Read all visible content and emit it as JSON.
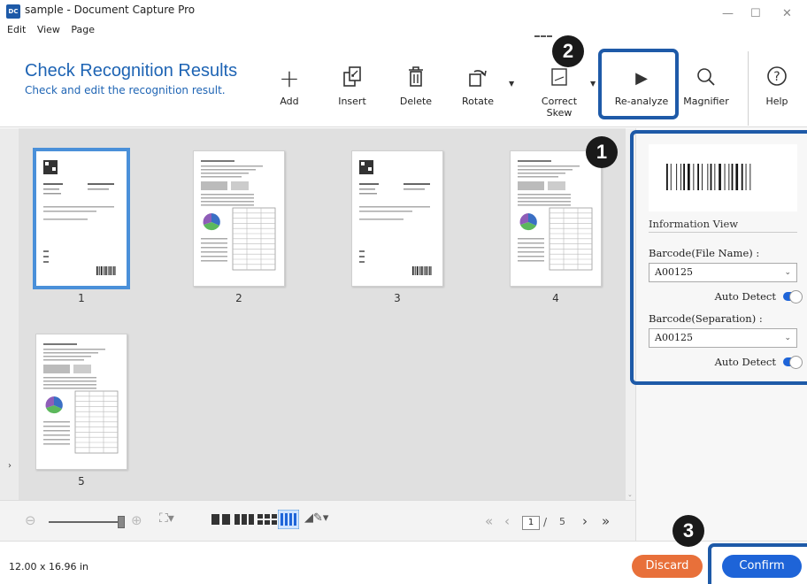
{
  "window": {
    "title": "sample - Document Capture Pro",
    "icon_text": "DC",
    "menu": [
      "Edit",
      "View",
      "Page"
    ],
    "controls": {
      "minimize": "—",
      "maximize": "☐",
      "close": "✕"
    }
  },
  "header": {
    "title": "Check Recognition Results",
    "subtitle": "Check and edit the recognition result."
  },
  "toolbar": {
    "add": "Add",
    "insert": "Insert",
    "delete": "Delete",
    "rotate": "Rotate",
    "correct_skew_1": "Correct",
    "correct_skew_2": "Skew",
    "reanalyze": "Re-analyze",
    "magnifier": "Magnifier",
    "help": "Help"
  },
  "pages": [
    {
      "number": "1",
      "selected": true,
      "type": "barcode-sheet"
    },
    {
      "number": "2",
      "selected": false,
      "type": "report"
    },
    {
      "number": "3",
      "selected": false,
      "type": "barcode-sheet"
    },
    {
      "number": "4",
      "selected": false,
      "type": "report"
    },
    {
      "number": "5",
      "selected": false,
      "type": "report"
    }
  ],
  "pager": {
    "current": "1",
    "separator": "/",
    "total": "5"
  },
  "info_panel": {
    "heading": "Information View",
    "file_name_label": "Barcode(File Name) :",
    "file_name_value": "A00125",
    "separation_label": "Barcode(Separation) :",
    "separation_value": "A00125",
    "auto_detect": "Auto Detect",
    "auto_detect_on": true
  },
  "status": {
    "dimensions": "12.00 x 16.96 in"
  },
  "buttons": {
    "discard": "Discard",
    "confirm": "Confirm"
  },
  "callouts": [
    "1",
    "2",
    "3"
  ],
  "colors": {
    "accent": "#1e64b4",
    "discard": "#e8703a",
    "confirm": "#1e64d8",
    "highlight": "#1e5aa8"
  }
}
